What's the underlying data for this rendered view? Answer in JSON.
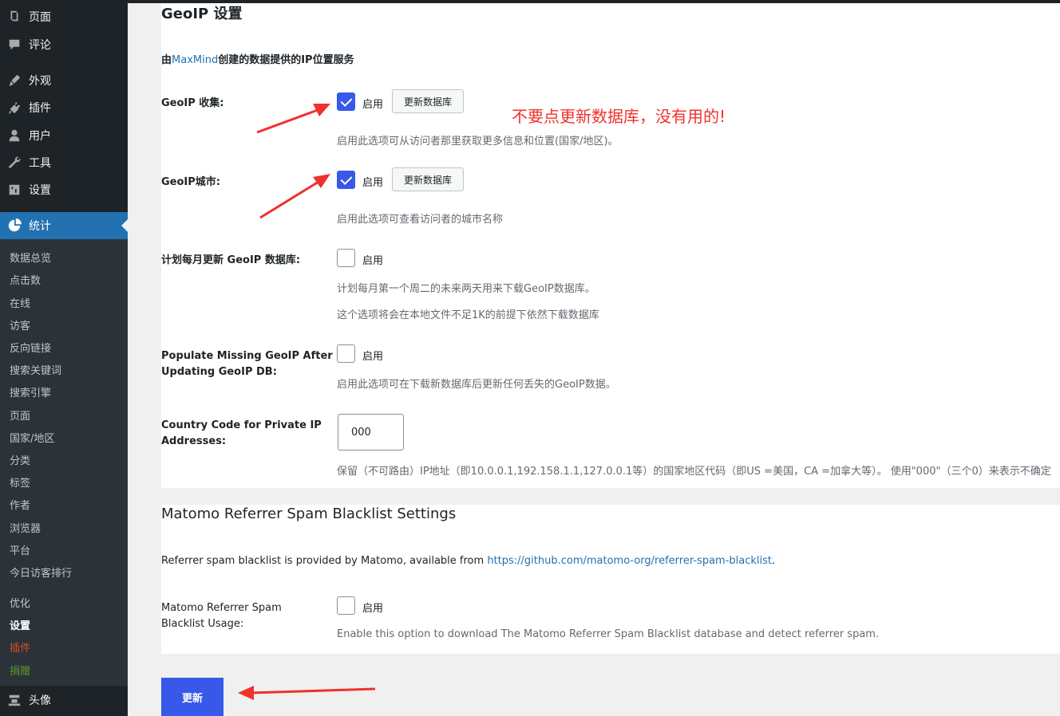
{
  "sidebar": {
    "menu": [
      {
        "label": "页面",
        "icon": "pages-icon"
      },
      {
        "label": "评论",
        "icon": "comments-icon"
      },
      {
        "label": "外观",
        "icon": "appearance-icon"
      },
      {
        "label": "插件",
        "icon": "plugins-icon"
      },
      {
        "label": "用户",
        "icon": "users-icon"
      },
      {
        "label": "工具",
        "icon": "tools-icon"
      },
      {
        "label": "设置",
        "icon": "settings-icon"
      },
      {
        "label": "统计",
        "icon": "statistics-icon"
      }
    ],
    "submenu": [
      "数据总览",
      "点击数",
      "在线",
      "访客",
      "反向链接",
      "搜索关键词",
      "搜索引擎",
      "页面",
      "国家/地区",
      "分类",
      "标签",
      "作者",
      "浏览器",
      "平台",
      "今日访客排行",
      "优化",
      "设置",
      "插件",
      "捐赠"
    ],
    "bottom": {
      "label": "头像",
      "icon": "avatar-icon"
    }
  },
  "geoip": {
    "title": "GeoIP 设置",
    "provider_prefix": "由",
    "provider_link": "MaxMind",
    "provider_suffix": "创建的数据提供的IP位置服务",
    "enable_label": "启用",
    "update_db_label": "更新数据库",
    "collection": {
      "label": "GeoIP 收集:",
      "checked": true,
      "desc": "启用此选项可从访问者那里获取更多信息和位置(国家/地区)。"
    },
    "city": {
      "label": "GeoIP城市:",
      "checked": true,
      "desc": "启用此选项可查看访问者的城市名称"
    },
    "monthly": {
      "label": "计划每月更新 GeoIP 数据库:",
      "checked": false,
      "desc1": "计划每月第一个周二的未来两天用来下载GeoIP数据库。",
      "desc2": "这个选项将会在本地文件不足1K的前提下依然下载数据库"
    },
    "populate": {
      "label1": "Populate Missing GeoIP After",
      "label2": "Updating GeoIP DB:",
      "checked": false,
      "desc": "启用此选项可在下载新数据库后更新任何丢失的GeoIP数据。"
    },
    "country_code": {
      "label1": "Country Code for Private IP",
      "label2": "Addresses:",
      "value": "000",
      "desc": "保留（不可路由）IP地址（即10.0.0.1,192.158.1.1,127.0.0.1等）的国家地区代码（即US =美国，CA =加拿大等）。 使用\"000\"（三个0）来表示不确定"
    }
  },
  "matomo": {
    "title": "Matomo Referrer Spam Blacklist Settings",
    "intro_prefix": "Referrer spam blacklist is provided by Matomo, available from ",
    "intro_link": "https://github.com/matomo-org/referrer-spam-blacklist",
    "intro_suffix": ".",
    "usage": {
      "label1": "Matomo Referrer Spam",
      "label2": "Blacklist Usage:",
      "checked": false,
      "desc": "Enable this option to download The Matomo Referrer Spam Blacklist database and detect referrer spam."
    }
  },
  "submit_label": "更新",
  "annotation": "不要点更新数据库，没有用的!",
  "colors": {
    "sidebar": "#1d2327",
    "active": "#2271b1",
    "primary": "#3858e9",
    "annotation": "#f0312c"
  }
}
